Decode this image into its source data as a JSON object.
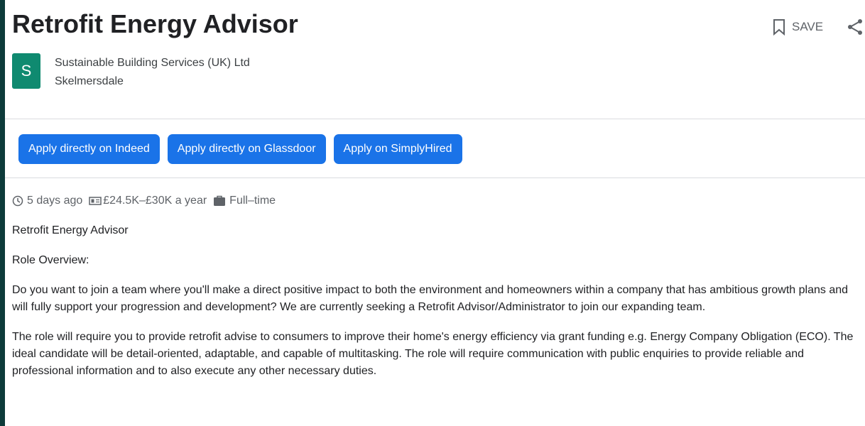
{
  "job": {
    "title": "Retrofit Energy Advisor",
    "logo_letter": "S",
    "company": "Sustainable Building Services (UK) Ltd",
    "location": "Skelmersdale"
  },
  "actions": {
    "save_label": "SAVE"
  },
  "apply_buttons": [
    "Apply directly on Indeed",
    "Apply directly on Glassdoor",
    "Apply on SimplyHired"
  ],
  "meta": {
    "posted": "5 days ago",
    "salary": "£24.5K–£30K a year",
    "type": "Full–time"
  },
  "description": [
    "Retrofit Energy Advisor",
    "Role Overview:",
    "Do you want to join a team where you'll make a direct positive impact to both the environment and homeowners within a company that has ambitious growth plans and will fully support your progression and development? We are currently seeking a Retrofit Advisor/Administrator to join our expanding team.",
    "The role will require you to provide retrofit advise to consumers to improve their home's energy efficiency via grant funding e.g. Energy Company Obligation (ECO). The ideal candidate will be detail-oriented, adaptable, and capable of multitasking. The role will require communication with public enquiries to provide reliable and professional information and to also execute any other necessary duties."
  ],
  "colors": {
    "background": "#0d3b3a",
    "logo": "#0f8a70",
    "button": "#1a73e8"
  }
}
